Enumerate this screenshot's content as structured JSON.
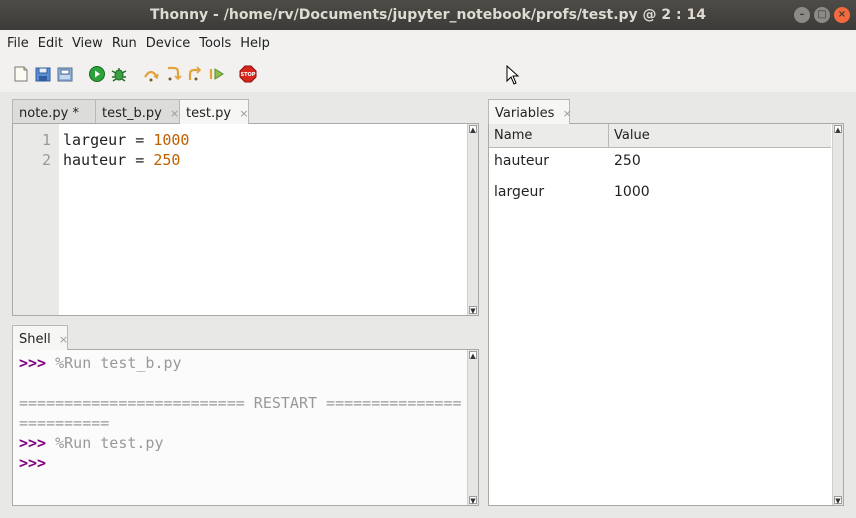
{
  "window": {
    "title": "Thonny  -  /home/rv/Documents/jupyter_notebook/profs/test.py  @  2 : 14",
    "controls": [
      "minimize-icon",
      "maximize-icon",
      "close-icon"
    ]
  },
  "menubar": {
    "items": [
      "File",
      "Edit",
      "View",
      "Run",
      "Device",
      "Tools",
      "Help"
    ]
  },
  "toolbar": {
    "buttons": [
      "new-file-icon",
      "open-file-icon",
      "save-file-icon",
      "run-icon",
      "debug-icon",
      "step-over-icon",
      "step-into-icon",
      "step-out-icon",
      "resume-icon",
      "stop-icon"
    ],
    "stop_label": "STOP"
  },
  "editor": {
    "tabs": [
      {
        "label": "note.py *",
        "active": false
      },
      {
        "label": "test_b.py",
        "active": false
      },
      {
        "label": "test.py",
        "active": true
      }
    ],
    "close_glyph": "×",
    "line_numbers": [
      "1",
      "2"
    ],
    "lines": [
      {
        "name": "largeur",
        "op": " = ",
        "value": "1000"
      },
      {
        "name": "hauteur",
        "op": " = ",
        "value": "250"
      }
    ]
  },
  "shell": {
    "tab_label": "Shell",
    "prompt": ">>>",
    "lines": [
      {
        "prompt": ">>>",
        "text": " %Run test_b.py"
      },
      {
        "prompt": "",
        "text": ""
      },
      {
        "prompt": "",
        "text": "========================= RESTART ==============="
      },
      {
        "prompt": "",
        "text": "=========="
      },
      {
        "prompt": ">>>",
        "text": " %Run test.py"
      },
      {
        "prompt": ">>>",
        "text": ""
      }
    ]
  },
  "variables": {
    "tab_label": "Variables",
    "columns": [
      "Name",
      "Value"
    ],
    "rows": [
      {
        "name": "hauteur",
        "value": "250"
      },
      {
        "name": "largeur",
        "value": "1000"
      }
    ]
  },
  "colors": {
    "number": "#c05f00",
    "prompt": "#800080",
    "titlebar": "#3c3b37"
  }
}
